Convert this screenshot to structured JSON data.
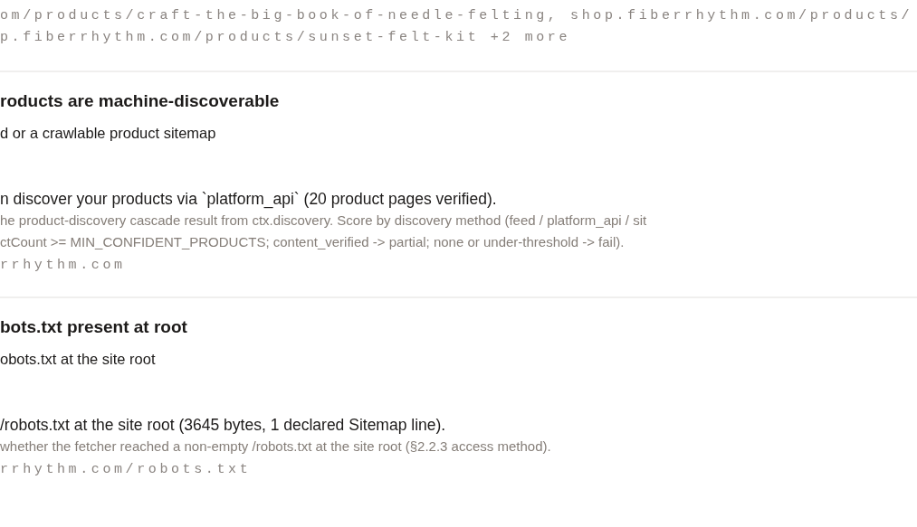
{
  "evidence_lines": [
    "om/products/craft-the-big-book-of-needle-felting, shop.fiberrhythm.com/products/",
    "p.fiberrhythm.com/products/sunset-felt-kit +2 more"
  ],
  "checks": [
    {
      "title": "roducts are machine-discoverable",
      "description": "d or a crawlable product sitemap",
      "result": "n discover your products via `platform_api` (20 product pages verified).",
      "method": [
        "he product-discovery cascade result from ctx.discovery. Score by discovery method (feed / platform_api / sit",
        "ctCount >= MIN_CONFIDENT_PRODUCTS; content_verified -> partial; none or under-threshold -> fail)."
      ],
      "evidence": [
        "rrhythm.com"
      ]
    },
    {
      "title": "bots.txt present at root",
      "description": "obots.txt at the site root",
      "result": "/robots.txt at the site root (3645 bytes, 1 declared Sitemap line).",
      "method": [
        "whether the fetcher reached a non-empty /robots.txt at the site root (§2.2.3 access method)."
      ],
      "evidence": [
        "rrhythm.com/robots.txt"
      ]
    }
  ]
}
